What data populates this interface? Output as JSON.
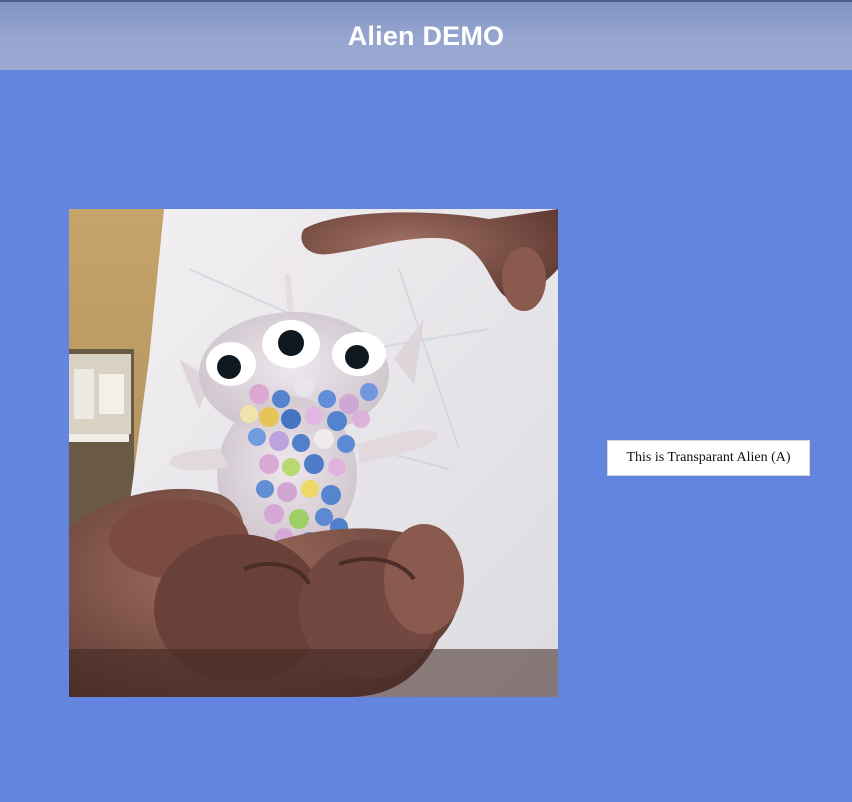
{
  "header": {
    "title": "Alien DEMO"
  },
  "camera": {
    "icon": "alien-toy-photo"
  },
  "prediction": {
    "label": "This is Transparant Alien (A)"
  },
  "colors": {
    "background": "#6385e0",
    "header": "#9aa9d0",
    "header_text": "#ffffff",
    "label_background": "#ffffff"
  }
}
